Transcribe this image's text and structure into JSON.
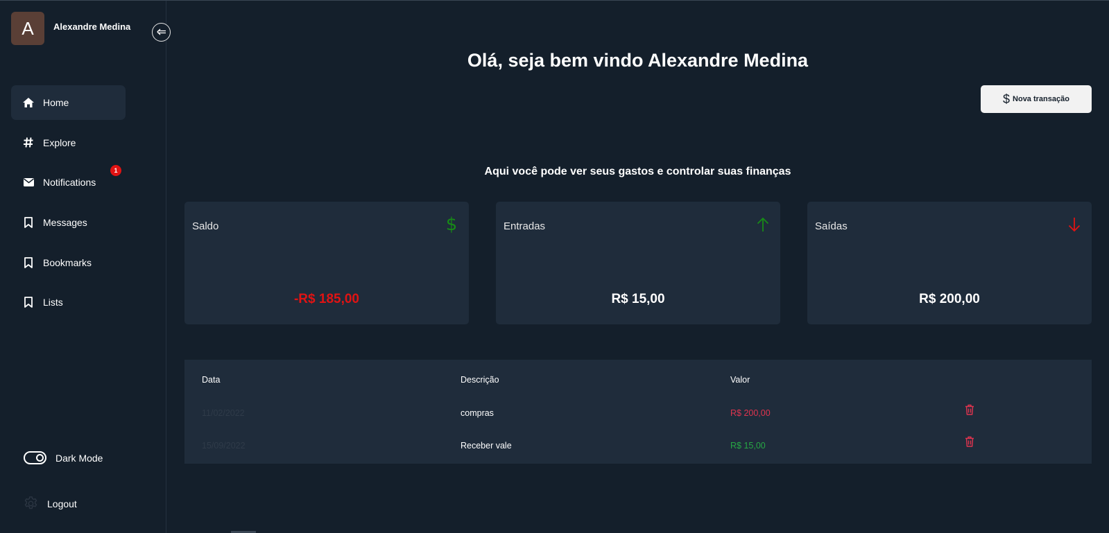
{
  "user": {
    "avatar_letter": "A",
    "name": "Alexandre Medina"
  },
  "sidebar": {
    "items": [
      {
        "label": "Home",
        "icon": "home-icon",
        "active": true
      },
      {
        "label": "Explore",
        "icon": "hash-icon"
      },
      {
        "label": "Notifications",
        "icon": "envelope-icon",
        "badge": "1"
      },
      {
        "label": "Messages",
        "icon": "bookmark-icon"
      },
      {
        "label": "Bookmarks",
        "icon": "bookmark-icon"
      },
      {
        "label": "Lists",
        "icon": "bookmark-icon"
      }
    ],
    "dark_mode_label": "Dark Mode",
    "logout_label": "Logout"
  },
  "main": {
    "greeting": "Olá, seja bem vindo Alexandre Medina",
    "new_transaction_label": "Nova transação",
    "subtitle": "Aqui você pode ver seus gastos e controlar suas finanças",
    "cards": [
      {
        "label": "Saldo",
        "value": "-R$ 185,00",
        "icon": "dollar-icon",
        "color": "#e11313"
      },
      {
        "label": "Entradas",
        "value": "R$ 15,00",
        "icon": "arrow-up-icon",
        "color": "#ffffff"
      },
      {
        "label": "Saídas",
        "value": "R$ 200,00",
        "icon": "arrow-down-icon",
        "color": "#ffffff"
      }
    ]
  },
  "table": {
    "headers": [
      "Data",
      "Descrição",
      "Valor"
    ],
    "rows": [
      {
        "date": "11/02/2022",
        "description": "compras",
        "value": "R$ 200,00",
        "type": "out"
      },
      {
        "date": "15/09/2022",
        "description": "Receber vale",
        "value": "R$ 15,00",
        "type": "in"
      }
    ]
  },
  "colors": {
    "background": "#141f2b",
    "surface": "#1f2c3b",
    "negative": "#e0344f",
    "positive": "#27a844",
    "icon_green": "#178a17",
    "icon_red": "#e11313",
    "date_text": "#2f3b49"
  }
}
